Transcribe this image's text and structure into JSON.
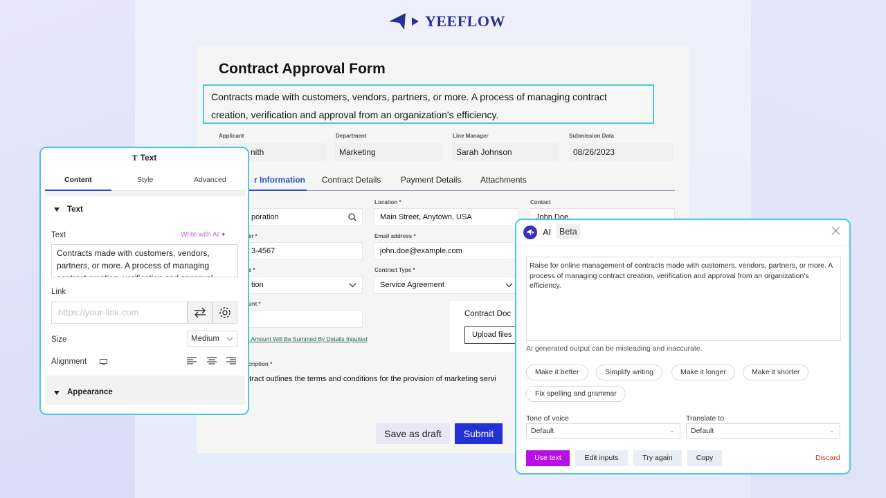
{
  "brand": {
    "name": "YEEFLOW"
  },
  "form": {
    "title": "Contract Approval Form",
    "description": "Contracts made with customers, vendors, partners, or more. A process of managing contract creation, verification and approval from an organization's efficiency.",
    "meta": [
      {
        "label": "Applicant",
        "value": "nith"
      },
      {
        "label": "Department",
        "value": "Marketing"
      },
      {
        "label": "Line Manager",
        "value": "Sarah Johnson"
      },
      {
        "label": "Submission Data",
        "value": "08/26/2023"
      }
    ],
    "tabs": [
      "r Information",
      "Contract Details",
      "Payment Details",
      "Attachments"
    ],
    "fields": {
      "company_value": "poration",
      "location_label": "Location *",
      "location_value": "Main Street, Anytown, USA",
      "contact_label": "Contact",
      "contact_value": "John Doe",
      "phone_label": "ber *",
      "phone_value": "3-4567",
      "email_label": "Email address *",
      "email_value": "john.doe@example.com",
      "stage_label": "ge *",
      "stage_value": "tion",
      "contract_type_label": "Contract Type *",
      "contract_type_value": "Service Agreement",
      "amount_label": "ount *",
      "amount_note": "ct  Amount Will Be Summed By Details Inputted",
      "contract_doc_label": "Contract Doc",
      "upload_label": "Upload files",
      "desc_label": "scription *",
      "desc_value": "ntract outlines the terms and conditions for the provision of marketing servi"
    },
    "buttons": {
      "save": "Save as draft",
      "submit": "Submit"
    }
  },
  "text_panel": {
    "header": "Text",
    "tabs": [
      "Content",
      "Style",
      "Advanced"
    ],
    "section_text": "Text",
    "text_label": "Text",
    "ai_link": "Write with AI",
    "text_value": "Contracts made with customers, vendors, partners, or more. A process of managing contract creation, verification and approval",
    "link_label": "Link",
    "link_placeholder": "https://your-link.com",
    "size_label": "Size",
    "size_value": "Medium",
    "alignment_label": "Alignment",
    "section_appearance": "Appearance"
  },
  "ai_panel": {
    "title": "AI",
    "badge": "Beta",
    "output": "Raise for online management of contracts made with customers, vendors, partners, or more. A process of managing contract creation, verification and approval from an organization's efficiency.",
    "warning": "AI generated output can be misleading and inaccurate.",
    "chips": [
      "Make it better",
      "Simplify writing",
      "Make it longer",
      "Make it shorter",
      "Fix spelling and grammar"
    ],
    "tone_label": "Tone of voice",
    "tone_value": "Default",
    "translate_label": "Translate to",
    "translate_value": "Default",
    "actions": {
      "use": "Use text",
      "edit": "Edit inputs",
      "retry": "Try again",
      "copy": "Copy",
      "discard": "Discard"
    }
  },
  "colors": {
    "accent": "#2d4fc7",
    "highlight": "#4cc9dc",
    "ai_primary": "#b70fe6",
    "submit": "#2332d6"
  }
}
